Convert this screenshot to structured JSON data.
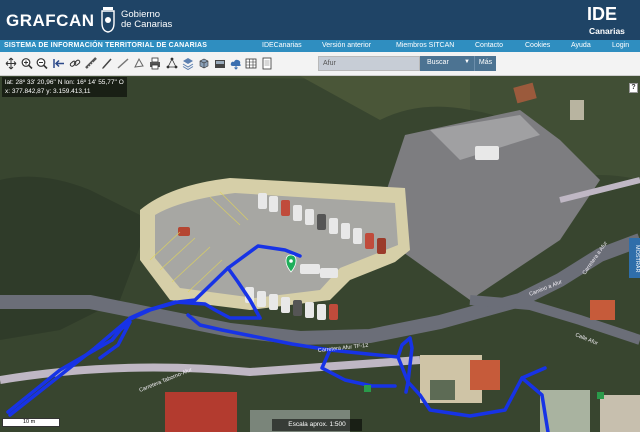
{
  "header": {
    "logo": "GRAFCAN",
    "gov_line1": "Gobierno",
    "gov_line2": "de Canarias",
    "ide_logo": "IDE",
    "ide_sub": "Canarias"
  },
  "navbar": {
    "system_title": "SISTEMA DE INFORMACIÓN TERRITORIAL DE CANARIAS",
    "links": [
      "IDECanarias",
      "Versión anterior",
      "Miembros SITCAN",
      "Contacto",
      "Cookies",
      "Ayuda",
      "Login"
    ]
  },
  "toolbar": {
    "search_placeholder": "Afur",
    "search_button": "Buscar",
    "more_button": "Más",
    "help_label": "?",
    "tools": [
      "pan-icon",
      "zoom-in-icon",
      "zoom-out-icon",
      "previous-view-icon",
      "link-icon",
      "measure-icon",
      "draw-icon",
      "print-icon",
      "network-icon",
      "layers-icon",
      "3d-icon",
      "cloud-icon",
      "table-icon",
      "document-icon"
    ]
  },
  "map": {
    "coord_line1": "lat: 28º 33' 20,96'' N   lon: 16º 14' 55,77'' O",
    "coord_line2": "x: 377.842,87   y: 3.159.413,11",
    "side_tab": "MOSTRAR",
    "scale_label": "10 m",
    "footer_scale": "Escala aprox. 1:500",
    "road_labels": [
      "Carretera Taborno-Afur",
      "Carretera Afur TF-12",
      "Camino a Afur",
      "Calle Afur",
      "Carretera a Afur"
    ]
  },
  "colors": {
    "header_bg": "#1f4466",
    "nav_bg": "#2f8ec0",
    "track": "#1733e6",
    "marker": "#1fae5a"
  }
}
